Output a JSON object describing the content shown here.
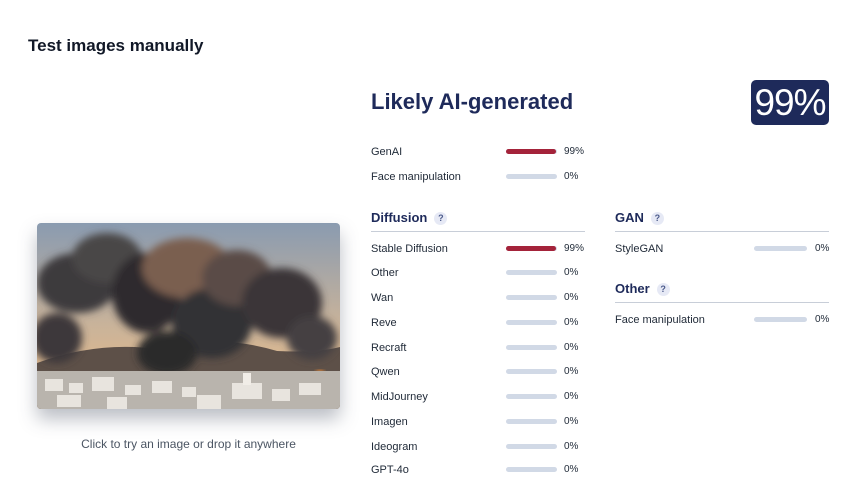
{
  "page": {
    "title": "Test images manually"
  },
  "upload": {
    "hint": "Click to try an image or drop it anywhere"
  },
  "result": {
    "verdict": "Likely AI-generated",
    "score": "99%"
  },
  "summary": [
    {
      "label": "GenAI",
      "value": 0.99,
      "pct": "99%"
    },
    {
      "label": "Face manipulation",
      "value": 0,
      "pct": "0%"
    }
  ],
  "diffusion": {
    "heading": "Diffusion",
    "help": "?",
    "items": [
      {
        "label": "Stable Diffusion",
        "value": 0.99,
        "pct": "99%"
      },
      {
        "label": "Other",
        "value": 0,
        "pct": "0%"
      },
      {
        "label": "Wan",
        "value": 0,
        "pct": "0%"
      },
      {
        "label": "Reve",
        "value": 0,
        "pct": "0%"
      },
      {
        "label": "Recraft",
        "value": 0,
        "pct": "0%"
      },
      {
        "label": "Qwen",
        "value": 0,
        "pct": "0%"
      },
      {
        "label": "MidJourney",
        "value": 0,
        "pct": "0%"
      },
      {
        "label": "Imagen",
        "value": 0,
        "pct": "0%"
      },
      {
        "label": "Ideogram",
        "value": 0,
        "pct": "0%"
      },
      {
        "label": "GPT-4o",
        "value": 0,
        "pct": "0%"
      }
    ]
  },
  "gan": {
    "heading": "GAN",
    "help": "?",
    "items": [
      {
        "label": "StyleGAN",
        "value": 0,
        "pct": "0%"
      }
    ]
  },
  "other": {
    "heading": "Other",
    "help": "?",
    "items": [
      {
        "label": "Face manipulation",
        "value": 0,
        "pct": "0%"
      }
    ]
  },
  "colors": {
    "accent": "#1e2a5a",
    "bar_fill": "#a4233a",
    "bar_track": "#d1d9e6"
  }
}
